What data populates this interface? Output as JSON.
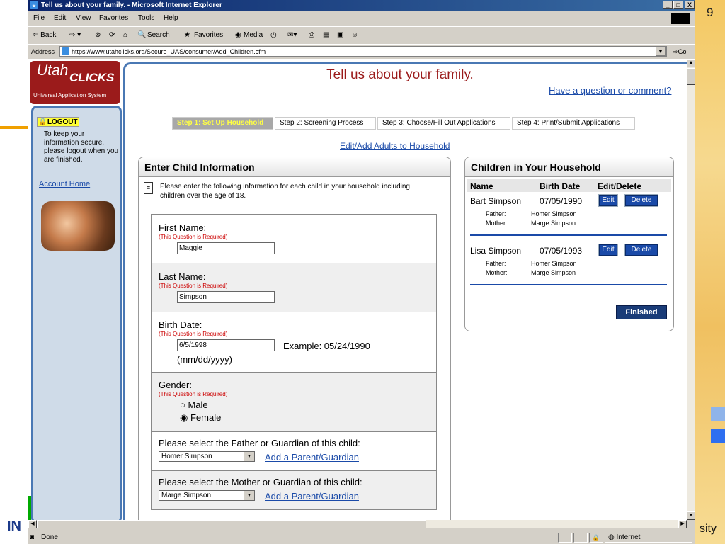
{
  "slide": {
    "page_number": "9",
    "footer_left": "IN",
    "footer_right": "sity"
  },
  "window": {
    "title": "Tell us about your family. - Microsoft Internet Explorer",
    "controls": [
      "_",
      "□",
      "X"
    ]
  },
  "menu": [
    "File",
    "Edit",
    "View",
    "Favorites",
    "Tools",
    "Help"
  ],
  "toolbar": {
    "back": "⇦ Back",
    "search": "Search",
    "favorites": "Favorites",
    "media": "Media"
  },
  "address": {
    "label": "Address",
    "url": "https://www.utahclicks.org/Secure_UAS/consumer/Add_Children.cfm",
    "go": "Go"
  },
  "status": {
    "text": "Done",
    "zone": "Internet"
  },
  "sidebar": {
    "logo_utah": "Utah",
    "logo_clicks": "CLICKS",
    "logo_subtitle": "Universal Application System",
    "logout": "LOGOUT",
    "logout_note": "To keep your information secure, please logout when you are finished.",
    "account_home": "Account Home"
  },
  "page": {
    "title": "Tell us about your family.",
    "question_link": "Have a question or comment?",
    "steps": [
      {
        "label": "Step 1: Set Up Household"
      },
      {
        "label": "Step 2: Screening Process"
      },
      {
        "label": "Step 3: Choose/Fill Out Applications"
      },
      {
        "label": "Step 4: Print/Submit Applications"
      }
    ],
    "edit_adults": "Edit/Add Adults to Household"
  },
  "child_form": {
    "heading": "Enter Child Information",
    "note": "Please enter the following information for each child in your household including children over the age of 18.",
    "required_text": "(This Question is Required)",
    "first_name_label": "First Name:",
    "first_name_value": "Maggie",
    "last_name_label": "Last Name:",
    "last_name_value": "Simpson",
    "birth_date_label": "Birth Date:",
    "birth_date_value": "6/5/1998",
    "birth_date_example": "Example: 05/24/1990",
    "birth_date_format": "(mm/dd/yyyy)",
    "gender_label": "Gender:",
    "gender_male": "Male",
    "gender_female": "Female",
    "father_label": "Please select the Father or Guardian of this child:",
    "father_value": "Homer Simpson",
    "mother_label": "Please select the Mother or Guardian of this child:",
    "mother_value": "Marge Simpson",
    "add_parent": "Add a Parent/Guardian"
  },
  "household": {
    "heading": "Children in Your Household",
    "col_name": "Name",
    "col_birth": "Birth Date",
    "col_edit": "Edit/Delete",
    "father_label": "Father:",
    "mother_label": "Mother:",
    "edit": "Edit",
    "delete": "Delete",
    "finished": "Finished",
    "children": [
      {
        "name": "Bart Simpson",
        "birth": "07/05/1990",
        "father": "Homer Simpson",
        "mother": "Marge Simpson"
      },
      {
        "name": "Lisa Simpson",
        "birth": "07/05/1993",
        "father": "Homer Simpson",
        "mother": "Marge Simpson"
      }
    ]
  }
}
